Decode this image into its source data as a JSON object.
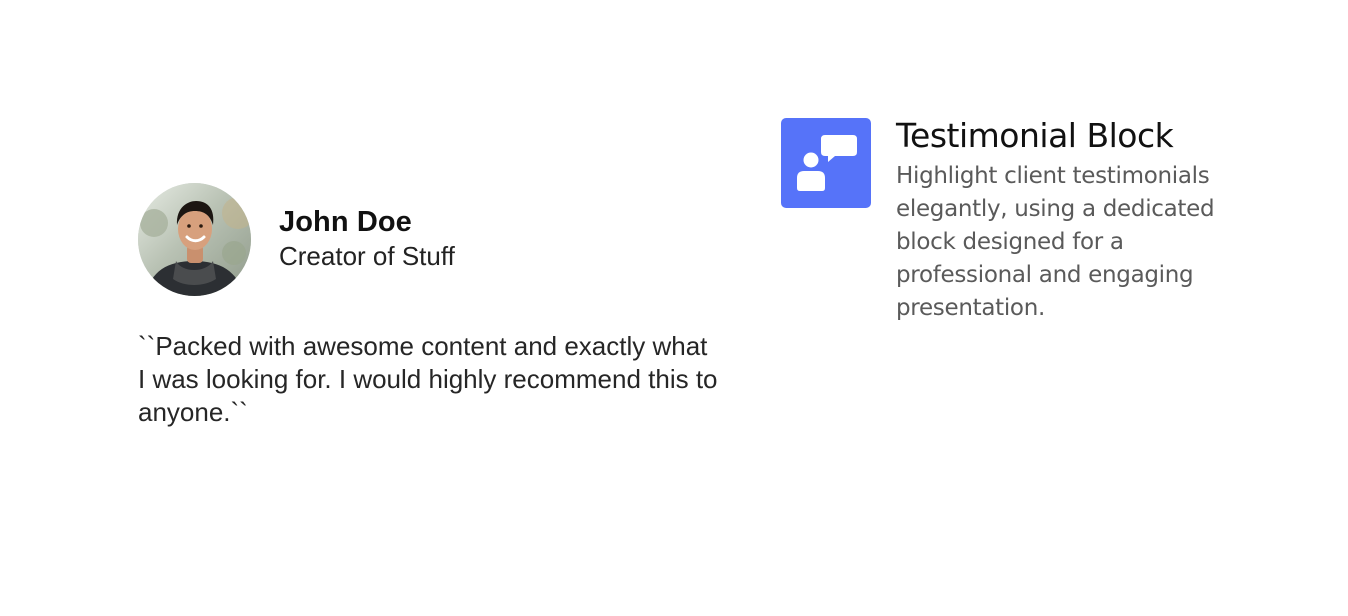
{
  "testimonial": {
    "author_name": "John Doe",
    "author_role": "Creator of Stuff",
    "quote": "``Packed with awesome content and exactly what I was looking for. I would highly recommend this to anyone.``",
    "avatar_icon": "avatar-photo"
  },
  "feature": {
    "icon": "chat-user-icon",
    "icon_color": "#5673f9",
    "title": "Testimonial Block",
    "description": "Highlight client testimonials elegantly, using a dedicated block designed for a professional and engaging presentation."
  }
}
